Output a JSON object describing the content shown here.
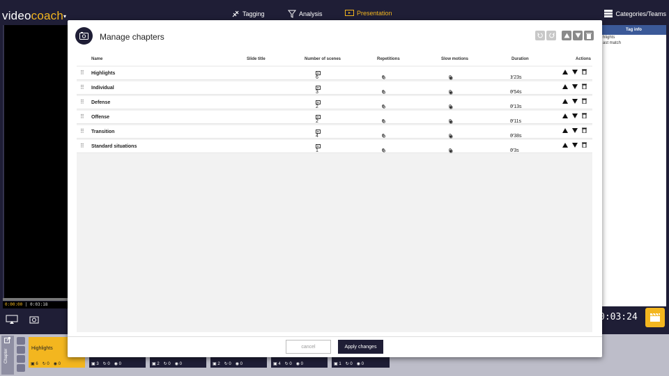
{
  "app": {
    "logo_video": "video",
    "logo_coach": "coach",
    "nav": [
      {
        "label": "Tagging",
        "icon": "tagging-icon",
        "active": false
      },
      {
        "label": "Analysis",
        "icon": "funnel-icon",
        "active": false
      },
      {
        "label": "Presentation",
        "icon": "presentation-icon",
        "active": true
      }
    ],
    "categories_label": "Categories/Teams",
    "accent_color": "#f3b61f",
    "brand_dark": "#1f1e36"
  },
  "background": {
    "timecode_current": "0:00:00",
    "timecode_total": "0:03:18",
    "clock": "0:03:24",
    "tag_info_header": "Tag info",
    "tag_info_lines": [
      "hlights",
      "ast match"
    ],
    "strip_label": "Chapter",
    "chips": [
      {
        "label": "Highlights",
        "scenes": "6",
        "reps": "0",
        "slow": "0"
      },
      {
        "label": "",
        "scenes": "3",
        "reps": "0",
        "slow": "0"
      },
      {
        "label": "",
        "scenes": "2",
        "reps": "0",
        "slow": "0"
      },
      {
        "label": "",
        "scenes": "2",
        "reps": "0",
        "slow": "0"
      },
      {
        "label": "",
        "scenes": "4",
        "reps": "0",
        "slow": "0"
      },
      {
        "label": "",
        "scenes": "1",
        "reps": "0",
        "slow": "0"
      }
    ]
  },
  "modal": {
    "title": "Manage chapters",
    "columns": {
      "name": "Name",
      "slide_title": "Slide title",
      "scenes": "Number of scenes",
      "repetitions": "Repetitions",
      "slow": "Slow motions",
      "duration": "Duration",
      "actions": "Actions"
    },
    "rows": [
      {
        "name": "Highlights",
        "scenes": "6",
        "reps": "0",
        "slow": "0",
        "duration": "1'23s"
      },
      {
        "name": "Individual",
        "scenes": "3",
        "reps": "0",
        "slow": "0",
        "duration": "0'54s"
      },
      {
        "name": "Defense",
        "scenes": "2",
        "reps": "0",
        "slow": "0",
        "duration": "0'13s"
      },
      {
        "name": "Offense",
        "scenes": "2",
        "reps": "0",
        "slow": "0",
        "duration": "0'11s"
      },
      {
        "name": "Transition",
        "scenes": "4",
        "reps": "0",
        "slow": "0",
        "duration": "0'38s"
      },
      {
        "name": "Standard situations",
        "scenes": "1",
        "reps": "0",
        "slow": "0",
        "duration": "0'3s"
      }
    ],
    "cancel_label": "cancel",
    "apply_label": "Apply changes"
  }
}
